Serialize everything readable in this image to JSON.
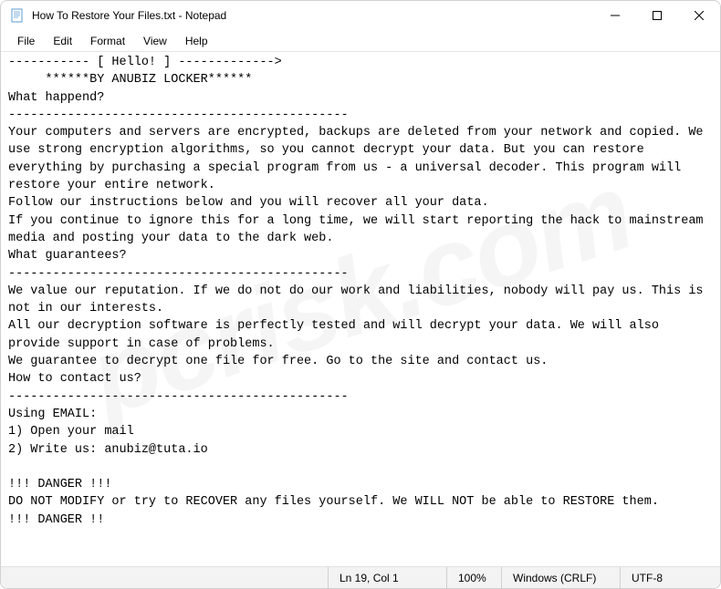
{
  "window": {
    "title": "How To Restore Your Files.txt - Notepad"
  },
  "menu": {
    "file": "File",
    "edit": "Edit",
    "format": "Format",
    "view": "View",
    "help": "Help"
  },
  "content": "----------- [ Hello! ] ------------->\n     ******BY ANUBIZ LOCKER******\nWhat happend?\n----------------------------------------------\nYour computers and servers are encrypted, backups are deleted from your network and copied. We use strong encryption algorithms, so you cannot decrypt your data. But you can restore everything by purchasing a special program from us - a universal decoder. This program will restore your entire network.\nFollow our instructions below and you will recover all your data.\nIf you continue to ignore this for a long time, we will start reporting the hack to mainstream media and posting your data to the dark web.\nWhat guarantees?\n----------------------------------------------\nWe value our reputation. If we do not do our work and liabilities, nobody will pay us. This is not in our interests.\nAll our decryption software is perfectly tested and will decrypt your data. We will also provide support in case of problems.\nWe guarantee to decrypt one file for free. Go to the site and contact us.\nHow to contact us?\n----------------------------------------------\nUsing EMAIL:\n1) Open your mail\n2) Write us: anubiz@tuta.io\n\n!!! DANGER !!!\nDO NOT MODIFY or try to RECOVER any files yourself. We WILL NOT be able to RESTORE them.\n!!! DANGER !!",
  "statusbar": {
    "position": "Ln 19, Col 1",
    "zoom": "100%",
    "line_ending": "Windows (CRLF)",
    "encoding": "UTF-8"
  },
  "watermark": "pcrisk.com"
}
